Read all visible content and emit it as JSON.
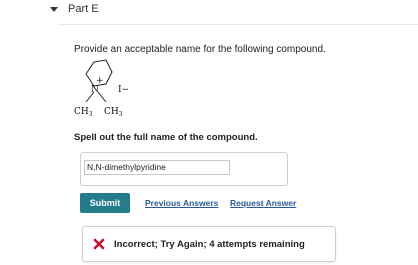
{
  "part": {
    "label": "Part E"
  },
  "question": {
    "prompt": "Provide an acceptable name for the following compound.",
    "molecule": {
      "n_label": "N",
      "charge": "+",
      "counterion": "I−",
      "left_group": "CH",
      "left_sub": "3",
      "right_group": "CH",
      "right_sub": "3"
    },
    "instruction": "Spell out the full name of the compound."
  },
  "answer": {
    "value": "N,N-dimethylpyridine"
  },
  "actions": {
    "submit_label": "Submit",
    "previous_answers_label": "Previous Answers",
    "request_answer_label": "Request Answer"
  },
  "feedback": {
    "text": "Incorrect; Try Again; 4 attempts remaining",
    "icon": "x-icon",
    "icon_color": "#c8102e"
  },
  "colors": {
    "accent": "#227c8c",
    "link": "#2a5a9a"
  }
}
